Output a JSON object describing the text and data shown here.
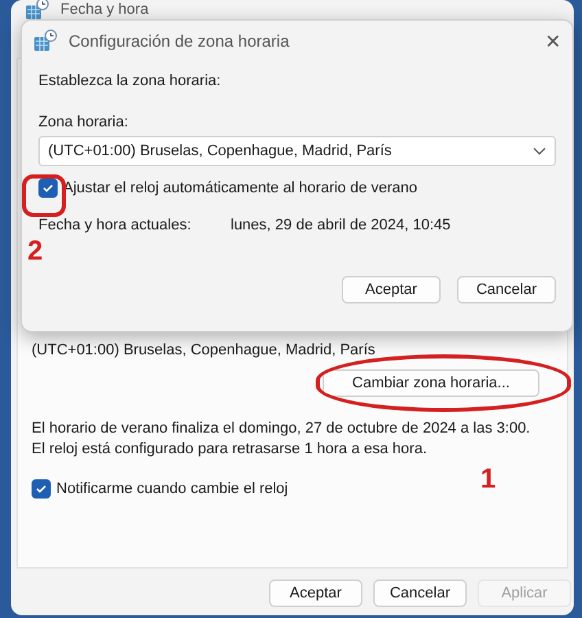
{
  "window": {
    "title": "Fecha y hora",
    "timezone_text": "(UTC+01:00) Bruselas, Copenhague, Madrid, París",
    "change_button": "Cambiar zona horaria...",
    "dst_info": "El horario de verano finaliza el domingo, 27 de octubre de 2024 a las 3:00. El reloj está configurado para retrasarse 1 hora a esa hora.",
    "notify": {
      "label": "Notificarme cuando cambie el reloj",
      "checked": true
    },
    "buttons": [
      {
        "label": "Aceptar",
        "disabled": false
      },
      {
        "label": "Cancelar",
        "disabled": false
      },
      {
        "label": "Aplicar",
        "disabled": true
      }
    ]
  },
  "dialog": {
    "title": "Configuración de zona horaria",
    "close": "✕",
    "prompt": "Establezca la zona horaria:",
    "zone_label": "Zona horaria:",
    "zone_value": "(UTC+01:00) Bruselas, Copenhague, Madrid, París",
    "dst_checkbox": {
      "label": "Ajustar el reloj automáticamente al horario de verano",
      "checked": true
    },
    "current_label": "Fecha y hora actuales:",
    "current_value": "lunes, 29 de abril de 2024, 10:45",
    "buttons": [
      {
        "label": "Aceptar",
        "disabled": false
      },
      {
        "label": "Cancelar",
        "disabled": false
      }
    ]
  },
  "annotations": [
    {
      "text": "2"
    },
    {
      "text": "1"
    }
  ]
}
